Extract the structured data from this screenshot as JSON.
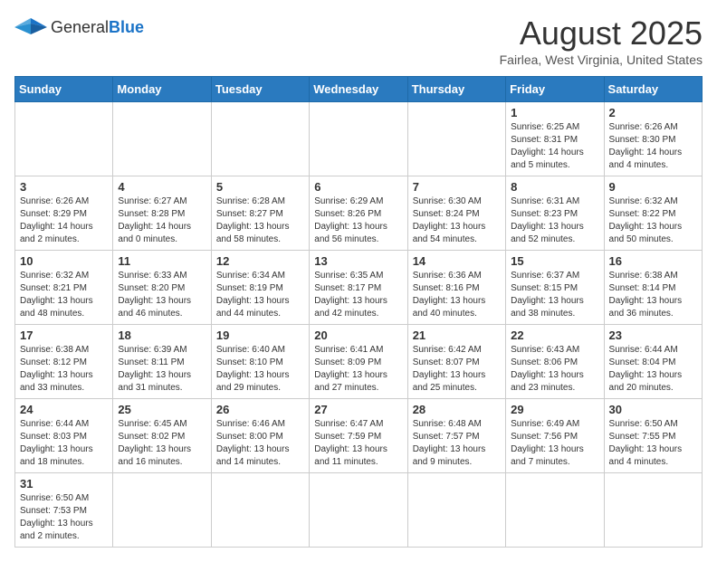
{
  "header": {
    "logo_general": "General",
    "logo_blue": "Blue",
    "title": "August 2025",
    "subtitle": "Fairlea, West Virginia, United States"
  },
  "weekdays": [
    "Sunday",
    "Monday",
    "Tuesday",
    "Wednesday",
    "Thursday",
    "Friday",
    "Saturday"
  ],
  "weeks": [
    [
      {
        "day": "",
        "info": ""
      },
      {
        "day": "",
        "info": ""
      },
      {
        "day": "",
        "info": ""
      },
      {
        "day": "",
        "info": ""
      },
      {
        "day": "",
        "info": ""
      },
      {
        "day": "1",
        "info": "Sunrise: 6:25 AM\nSunset: 8:31 PM\nDaylight: 14 hours and 5 minutes."
      },
      {
        "day": "2",
        "info": "Sunrise: 6:26 AM\nSunset: 8:30 PM\nDaylight: 14 hours and 4 minutes."
      }
    ],
    [
      {
        "day": "3",
        "info": "Sunrise: 6:26 AM\nSunset: 8:29 PM\nDaylight: 14 hours and 2 minutes."
      },
      {
        "day": "4",
        "info": "Sunrise: 6:27 AM\nSunset: 8:28 PM\nDaylight: 14 hours and 0 minutes."
      },
      {
        "day": "5",
        "info": "Sunrise: 6:28 AM\nSunset: 8:27 PM\nDaylight: 13 hours and 58 minutes."
      },
      {
        "day": "6",
        "info": "Sunrise: 6:29 AM\nSunset: 8:26 PM\nDaylight: 13 hours and 56 minutes."
      },
      {
        "day": "7",
        "info": "Sunrise: 6:30 AM\nSunset: 8:24 PM\nDaylight: 13 hours and 54 minutes."
      },
      {
        "day": "8",
        "info": "Sunrise: 6:31 AM\nSunset: 8:23 PM\nDaylight: 13 hours and 52 minutes."
      },
      {
        "day": "9",
        "info": "Sunrise: 6:32 AM\nSunset: 8:22 PM\nDaylight: 13 hours and 50 minutes."
      }
    ],
    [
      {
        "day": "10",
        "info": "Sunrise: 6:32 AM\nSunset: 8:21 PM\nDaylight: 13 hours and 48 minutes."
      },
      {
        "day": "11",
        "info": "Sunrise: 6:33 AM\nSunset: 8:20 PM\nDaylight: 13 hours and 46 minutes."
      },
      {
        "day": "12",
        "info": "Sunrise: 6:34 AM\nSunset: 8:19 PM\nDaylight: 13 hours and 44 minutes."
      },
      {
        "day": "13",
        "info": "Sunrise: 6:35 AM\nSunset: 8:17 PM\nDaylight: 13 hours and 42 minutes."
      },
      {
        "day": "14",
        "info": "Sunrise: 6:36 AM\nSunset: 8:16 PM\nDaylight: 13 hours and 40 minutes."
      },
      {
        "day": "15",
        "info": "Sunrise: 6:37 AM\nSunset: 8:15 PM\nDaylight: 13 hours and 38 minutes."
      },
      {
        "day": "16",
        "info": "Sunrise: 6:38 AM\nSunset: 8:14 PM\nDaylight: 13 hours and 36 minutes."
      }
    ],
    [
      {
        "day": "17",
        "info": "Sunrise: 6:38 AM\nSunset: 8:12 PM\nDaylight: 13 hours and 33 minutes."
      },
      {
        "day": "18",
        "info": "Sunrise: 6:39 AM\nSunset: 8:11 PM\nDaylight: 13 hours and 31 minutes."
      },
      {
        "day": "19",
        "info": "Sunrise: 6:40 AM\nSunset: 8:10 PM\nDaylight: 13 hours and 29 minutes."
      },
      {
        "day": "20",
        "info": "Sunrise: 6:41 AM\nSunset: 8:09 PM\nDaylight: 13 hours and 27 minutes."
      },
      {
        "day": "21",
        "info": "Sunrise: 6:42 AM\nSunset: 8:07 PM\nDaylight: 13 hours and 25 minutes."
      },
      {
        "day": "22",
        "info": "Sunrise: 6:43 AM\nSunset: 8:06 PM\nDaylight: 13 hours and 23 minutes."
      },
      {
        "day": "23",
        "info": "Sunrise: 6:44 AM\nSunset: 8:04 PM\nDaylight: 13 hours and 20 minutes."
      }
    ],
    [
      {
        "day": "24",
        "info": "Sunrise: 6:44 AM\nSunset: 8:03 PM\nDaylight: 13 hours and 18 minutes."
      },
      {
        "day": "25",
        "info": "Sunrise: 6:45 AM\nSunset: 8:02 PM\nDaylight: 13 hours and 16 minutes."
      },
      {
        "day": "26",
        "info": "Sunrise: 6:46 AM\nSunset: 8:00 PM\nDaylight: 13 hours and 14 minutes."
      },
      {
        "day": "27",
        "info": "Sunrise: 6:47 AM\nSunset: 7:59 PM\nDaylight: 13 hours and 11 minutes."
      },
      {
        "day": "28",
        "info": "Sunrise: 6:48 AM\nSunset: 7:57 PM\nDaylight: 13 hours and 9 minutes."
      },
      {
        "day": "29",
        "info": "Sunrise: 6:49 AM\nSunset: 7:56 PM\nDaylight: 13 hours and 7 minutes."
      },
      {
        "day": "30",
        "info": "Sunrise: 6:50 AM\nSunset: 7:55 PM\nDaylight: 13 hours and 4 minutes."
      }
    ],
    [
      {
        "day": "31",
        "info": "Sunrise: 6:50 AM\nSunset: 7:53 PM\nDaylight: 13 hours and 2 minutes."
      },
      {
        "day": "",
        "info": ""
      },
      {
        "day": "",
        "info": ""
      },
      {
        "day": "",
        "info": ""
      },
      {
        "day": "",
        "info": ""
      },
      {
        "day": "",
        "info": ""
      },
      {
        "day": "",
        "info": ""
      }
    ]
  ]
}
